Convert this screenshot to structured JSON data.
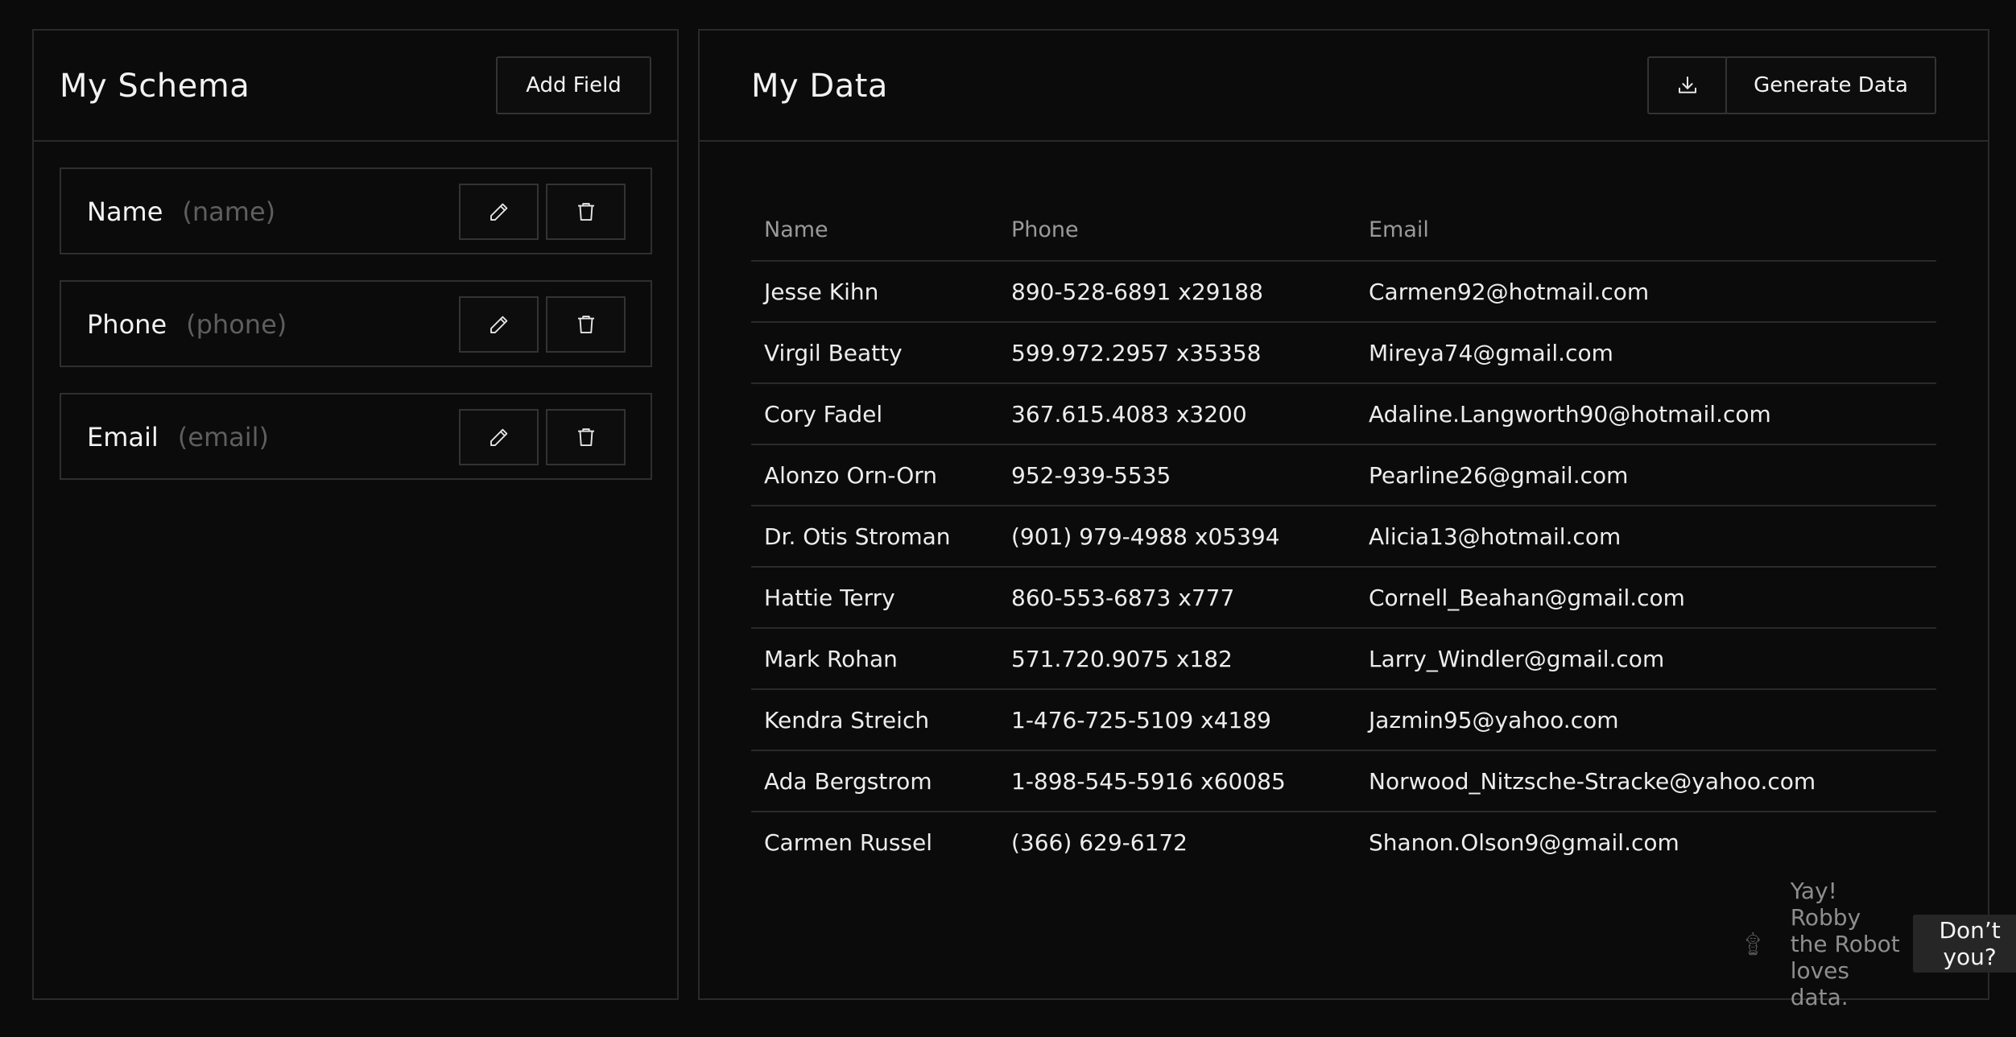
{
  "schema": {
    "title": "My Schema",
    "add_button": "Add Field",
    "fields": [
      {
        "label": "Name",
        "type": "(name)"
      },
      {
        "label": "Phone",
        "type": "(phone)"
      },
      {
        "label": "Email",
        "type": "(email)"
      }
    ]
  },
  "data": {
    "title": "My Data",
    "generate_button": "Generate Data",
    "columns": [
      "Name",
      "Phone",
      "Email"
    ],
    "rows": [
      [
        "Jesse Kihn",
        "890-528-6891 x29188",
        "Carmen92@hotmail.com"
      ],
      [
        "Virgil Beatty",
        "599.972.2957 x35358",
        "Mireya74@gmail.com"
      ],
      [
        "Cory Fadel",
        "367.615.4083 x3200",
        "Adaline.Langworth90@hotmail.com"
      ],
      [
        "Alonzo Orn-Orn",
        "952-939-5535",
        "Pearline26@gmail.com"
      ],
      [
        "Dr. Otis Stroman",
        "(901) 979-4988 x05394",
        "Alicia13@hotmail.com"
      ],
      [
        "Hattie Terry",
        "860-553-6873 x777",
        "Cornell_Beahan@gmail.com"
      ],
      [
        "Mark Rohan",
        "571.720.9075 x182",
        "Larry_Windler@gmail.com"
      ],
      [
        "Kendra Streich",
        "1-476-725-5109 x4189",
        "Jazmin95@yahoo.com"
      ],
      [
        "Ada Bergstrom",
        "1-898-545-5916 x60085",
        "Norwood_Nitzsche-Stracke@yahoo.com"
      ],
      [
        "Carmen Russel",
        "(366) 629-6172",
        "Shanon.Olson9@gmail.com"
      ]
    ],
    "footer_text": "Yay! Robby the Robot loves data.",
    "footer_button": "Don’t you?"
  },
  "icons": {
    "download": "download-icon",
    "edit": "pencil-icon",
    "delete": "trash-icon",
    "mascot": "robot-icon"
  }
}
